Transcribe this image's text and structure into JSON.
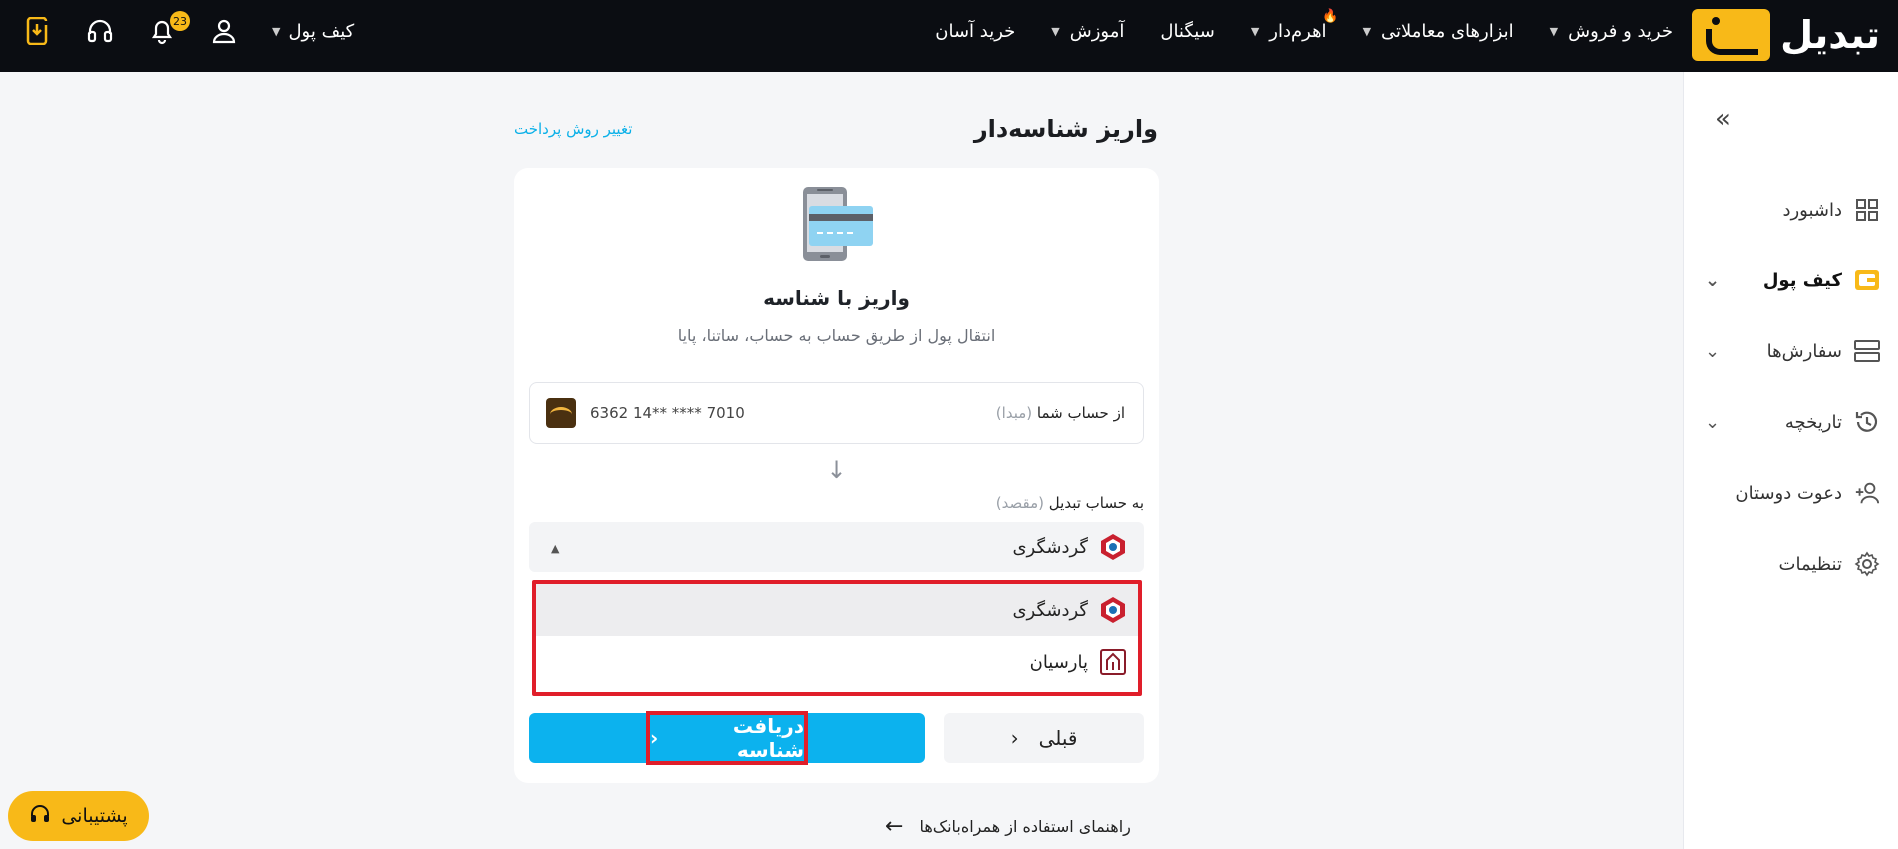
{
  "brand": {
    "name": "تبدیل",
    "accent": "#f8b918",
    "primary_button": "#0cb2ee",
    "highlight_border": "#e01e2a"
  },
  "nav": {
    "items": [
      {
        "label": "خرید و فروش",
        "caret": true
      },
      {
        "label": "ابزارهای معاملاتی",
        "caret": true
      },
      {
        "label": "اهرم‌دار",
        "caret": true,
        "hot": true
      },
      {
        "label": "سیگنال",
        "caret": false
      },
      {
        "label": "آموزش",
        "caret": true
      },
      {
        "label": "خرید آسان",
        "caret": false
      }
    ],
    "wallet_menu": "کیف پول",
    "notification_count": "23"
  },
  "sidebar": {
    "items": [
      {
        "label": "داشبورد",
        "icon": "dashboard-icon"
      },
      {
        "label": "کیف پول",
        "icon": "wallet-icon",
        "active": true,
        "expandable": true
      },
      {
        "label": "سفارش‌ها",
        "icon": "orders-icon",
        "expandable": true
      },
      {
        "label": "تاریخچه",
        "icon": "history-icon",
        "expandable": true
      },
      {
        "label": "دعوت دوستان",
        "icon": "invite-icon"
      },
      {
        "label": "تنظیمات",
        "icon": "settings-icon"
      }
    ]
  },
  "main": {
    "title": "واریز شناسه‌دار",
    "change_method": "تغییر روش پرداخت",
    "card": {
      "heading": "واریز با شناسه",
      "subtitle": "انتقال پول از طریق حساب به حساب، ساتنا، پایا",
      "from_label": "از حساب شما",
      "from_hint": "(مبدا)",
      "from_account": "6362 14** **** 7010",
      "to_label": "به حساب تبدیل",
      "to_hint": "(مقصد)",
      "selected_bank": "گردشگری",
      "options": [
        {
          "label": "گردشگری",
          "highlighted": true
        },
        {
          "label": "پارسیان",
          "highlighted": false
        }
      ],
      "prev_button": "قبلی",
      "get_id_button": "دریافت شناسه"
    },
    "guide_link": "راهنمای استفاده از همراه‌بانک‌ها"
  },
  "support_button": "پشتیبانی"
}
